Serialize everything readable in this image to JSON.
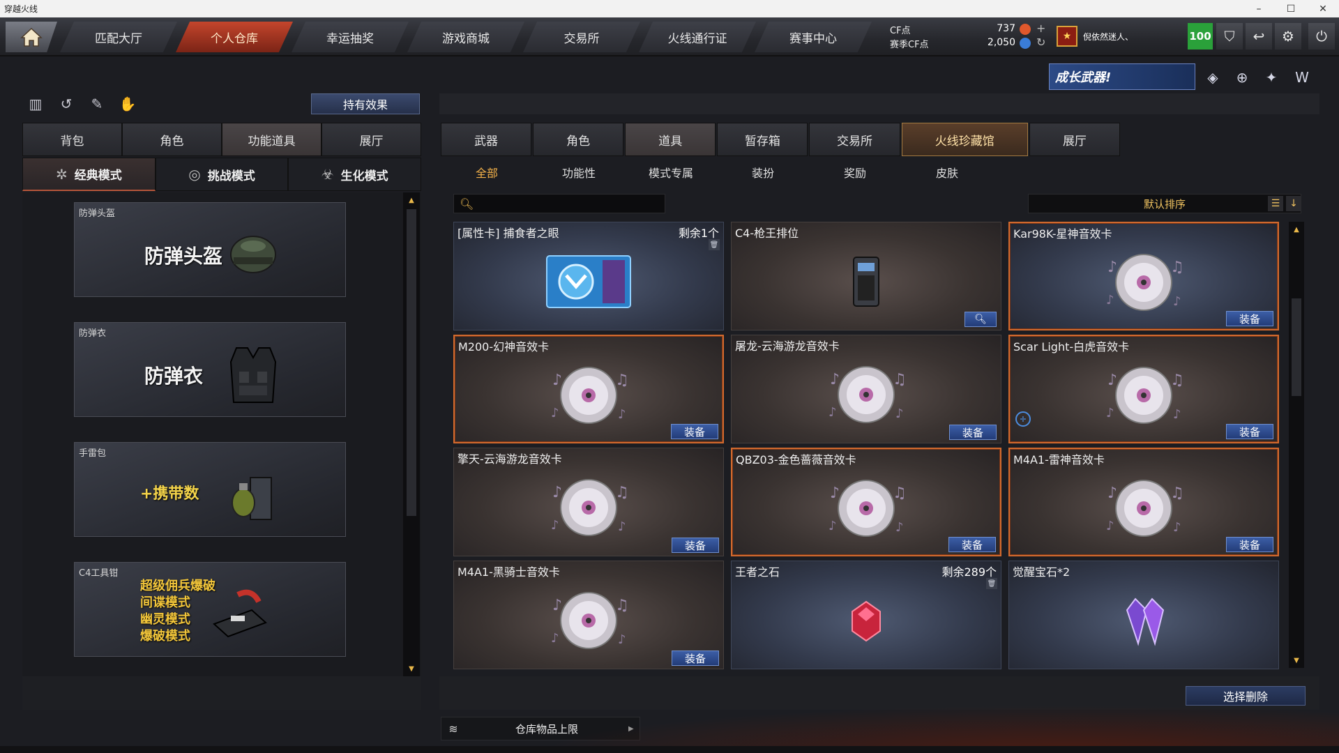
{
  "window": {
    "title": "穿越火线",
    "controls": [
      "–",
      "☐",
      "✕"
    ]
  },
  "top_nav": {
    "tabs": [
      {
        "label": "匹配大厅",
        "active": false
      },
      {
        "label": "个人仓库",
        "active": true
      },
      {
        "label": "幸运抽奖",
        "active": false
      },
      {
        "label": "游戏商城",
        "active": false
      },
      {
        "label": "交易所",
        "active": false
      },
      {
        "label": "火线通行证",
        "active": false
      },
      {
        "label": "赛事中心",
        "active": false
      }
    ],
    "currency": {
      "cf_label": "CF点",
      "cf_value": "737",
      "event_label": "赛季CF点",
      "event_value": "2,050",
      "add_symbol": "+",
      "refresh_symbol": "↻"
    },
    "player": {
      "name": "倪依然迷人、",
      "level": "100"
    }
  },
  "left_panel": {
    "effect_button": "持有效果",
    "tabs": [
      {
        "label": "背包",
        "active": false
      },
      {
        "label": "角色",
        "active": false
      },
      {
        "label": "功能道具",
        "active": true
      },
      {
        "label": "展厅",
        "active": false
      }
    ],
    "mode_tabs": [
      {
        "label": "经典模式",
        "active": true,
        "icon": "✲"
      },
      {
        "label": "挑战模式",
        "active": false,
        "icon": "◎"
      },
      {
        "label": "生化模式",
        "active": false,
        "icon": "☣"
      }
    ],
    "slots": [
      {
        "title": "防弹头盔",
        "big_text": "防弹头盔"
      },
      {
        "title": "防弹衣",
        "big_text": "防弹衣"
      },
      {
        "title": "手雷包",
        "big_text": "+携带数"
      },
      {
        "title": "C4工具钳",
        "lines": [
          "超级佣兵爆破",
          "间谍模式",
          "幽灵模式",
          "爆破模式"
        ]
      }
    ]
  },
  "right_panel": {
    "promo_text": "成长武器!",
    "tabs": [
      {
        "label": "武器",
        "active": false
      },
      {
        "label": "角色",
        "active": false
      },
      {
        "label": "道具",
        "active": true
      },
      {
        "label": "暂存箱",
        "active": false
      },
      {
        "label": "交易所",
        "active": false
      },
      {
        "label": "火线珍藏馆",
        "active": false,
        "gold": true
      },
      {
        "label": "展厅",
        "active": false
      }
    ],
    "sub_tabs": [
      {
        "label": "全部",
        "active": true
      },
      {
        "label": "功能性",
        "active": false
      },
      {
        "label": "模式专属",
        "active": false
      },
      {
        "label": "装扮",
        "active": false
      },
      {
        "label": "奖励",
        "active": false
      },
      {
        "label": "皮肤",
        "active": false
      }
    ],
    "search_placeholder": "",
    "sort_label": "默认排序",
    "equip_label": "装备",
    "items": [
      {
        "name": "[属性卡] 捕食者之眼",
        "qty": "剩余1个",
        "type": "card",
        "style": "blue",
        "selected": false,
        "action": "trash"
      },
      {
        "name": "C4-枪王排位",
        "qty": "",
        "type": "c4",
        "style": "brown",
        "selected": false,
        "action": "magnify"
      },
      {
        "name": "Kar98K-星神音效卡",
        "qty": "",
        "type": "disc",
        "style": "blue",
        "selected": true,
        "action": "equip"
      },
      {
        "name": "M200-幻神音效卡",
        "qty": "",
        "type": "disc",
        "style": "brown",
        "selected": true,
        "action": "equip"
      },
      {
        "name": "屠龙-云海游龙音效卡",
        "qty": "",
        "type": "disc",
        "style": "brown",
        "selected": false,
        "action": "equip"
      },
      {
        "name": "Scar Light-白虎音效卡",
        "qty": "",
        "type": "disc",
        "style": "brown",
        "selected": true,
        "action": "equip",
        "target": true
      },
      {
        "name": "擎天-云海游龙音效卡",
        "qty": "",
        "type": "disc",
        "style": "brown",
        "selected": false,
        "action": "equip"
      },
      {
        "name": "QBZ03-金色蔷薇音效卡",
        "qty": "",
        "type": "disc",
        "style": "brown",
        "selected": true,
        "action": "equip"
      },
      {
        "name": "M4A1-雷神音效卡",
        "qty": "",
        "type": "disc",
        "style": "brown",
        "selected": true,
        "action": "equip"
      },
      {
        "name": "M4A1-黑骑士音效卡",
        "qty": "",
        "type": "disc",
        "style": "brown",
        "selected": false,
        "action": "equip"
      },
      {
        "name": "王者之石",
        "qty": "剩余289个",
        "type": "ruby",
        "style": "blue",
        "selected": false,
        "action": "trash"
      },
      {
        "name": "觉醒宝石*2",
        "qty": "",
        "type": "gems",
        "style": "blue",
        "selected": false,
        "action": "none"
      }
    ],
    "delete_button": "选择删除",
    "capacity_label": "仓库物品上限"
  },
  "colors": {
    "accent_orange": "#d26a2e",
    "nav_active": "#c4452c",
    "equip_blue": "#3c5ea6",
    "gold_text": "#f1c360",
    "level_green": "#2aa13a"
  }
}
